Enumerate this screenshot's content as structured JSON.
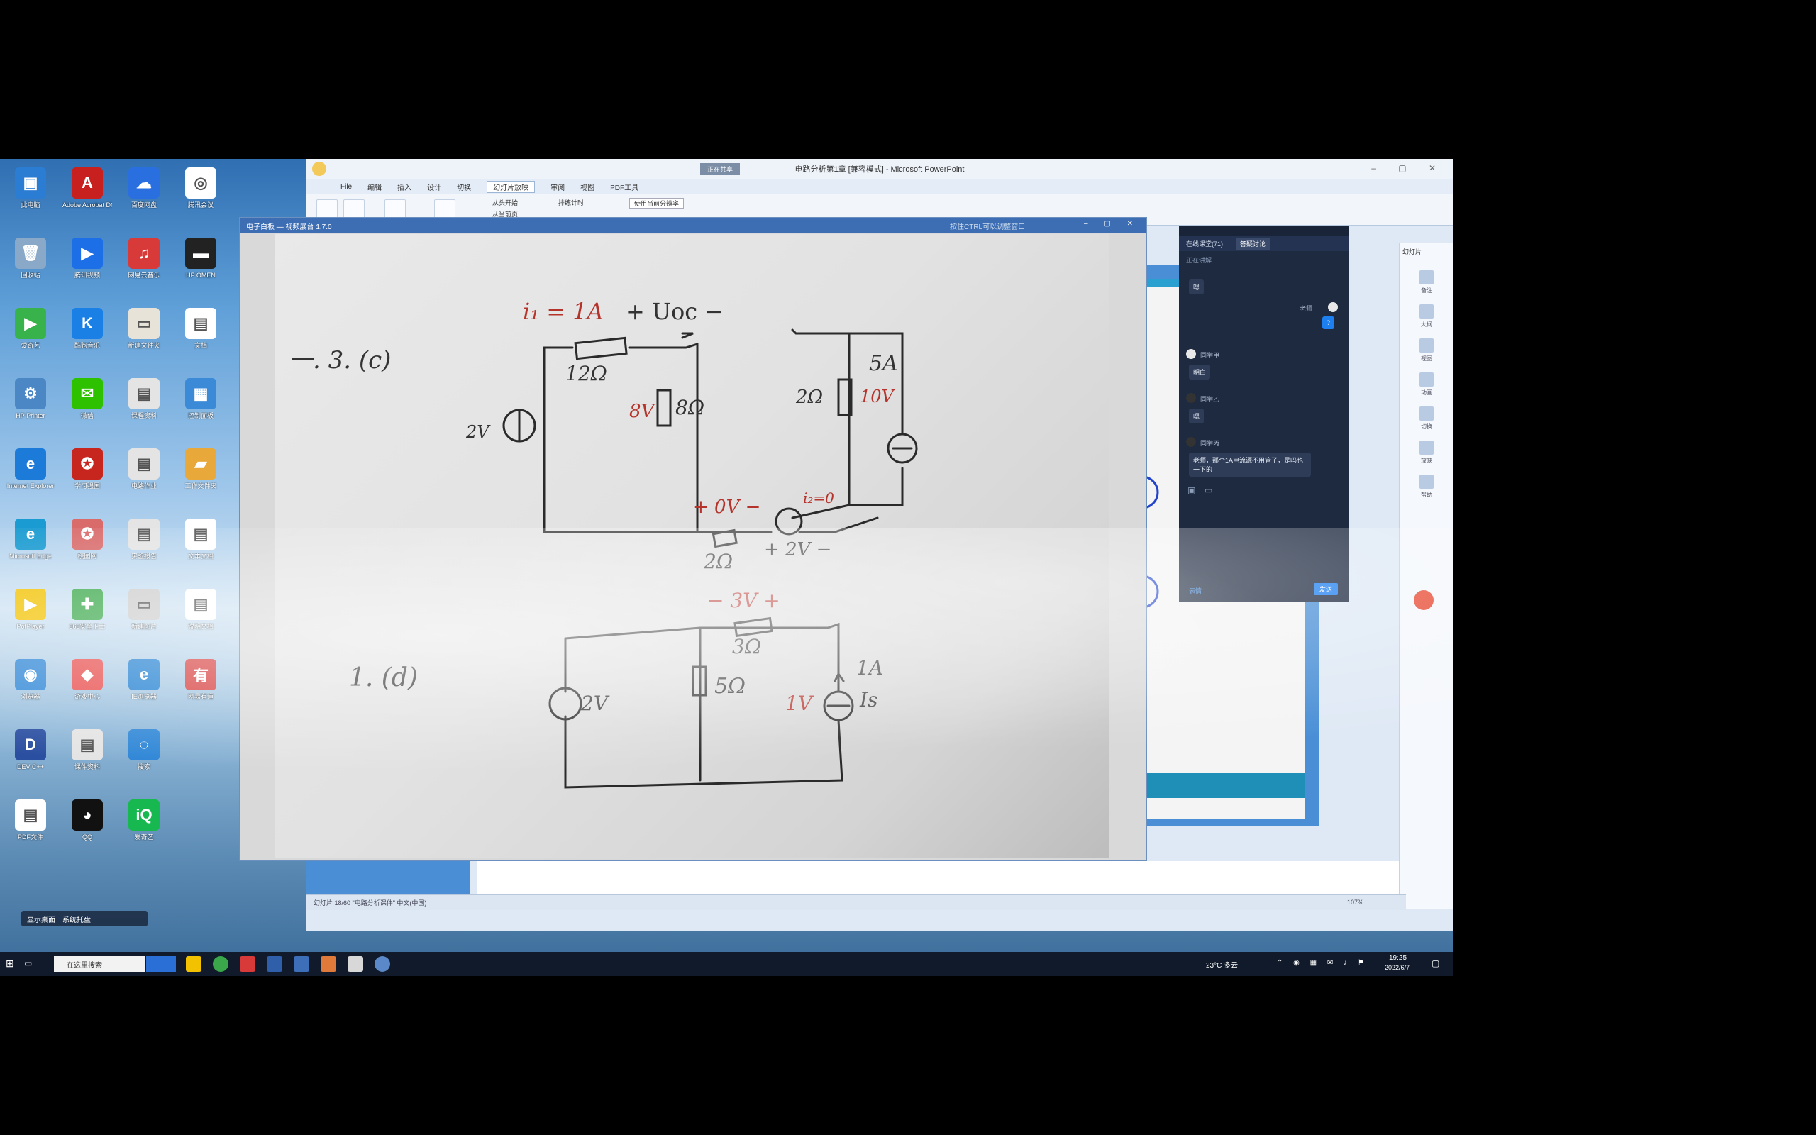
{
  "desktop_icons": [
    {
      "label": "此电脑",
      "color": "#2b7cd3",
      "glyph": "▣"
    },
    {
      "label": "Adobe Acrobat DC",
      "color": "#c8201e",
      "glyph": "A"
    },
    {
      "label": "百度网盘",
      "color": "#2a6fe0",
      "glyph": "☁"
    },
    {
      "label": "腾讯会议",
      "color": "#ffffff",
      "glyph": "◎"
    },
    {
      "label": "回收站",
      "color": "#8aa8c8",
      "glyph": "🗑"
    },
    {
      "label": "腾讯视频",
      "color": "#1d6fe8",
      "glyph": "▶"
    },
    {
      "label": "网易云音乐",
      "color": "#d83a3a",
      "glyph": "♫"
    },
    {
      "label": "HP OMEN",
      "color": "#222222",
      "glyph": "▬"
    },
    {
      "label": "爱奇艺",
      "color": "#38b24a",
      "glyph": "▶"
    },
    {
      "label": "酷狗音乐",
      "color": "#1a80e6",
      "glyph": "K"
    },
    {
      "label": "新建文件夹",
      "color": "#e8e3d9",
      "glyph": "▭"
    },
    {
      "label": "文档",
      "color": "#ffffff",
      "glyph": "▤"
    },
    {
      "label": "HP Printer",
      "color": "#4b87c4",
      "glyph": "⚙"
    },
    {
      "label": "微信",
      "color": "#2dc100",
      "glyph": "✉"
    },
    {
      "label": "课程资料",
      "color": "#e4e4e4",
      "glyph": "▤"
    },
    {
      "label": "控制面板",
      "color": "#3a8ad8",
      "glyph": "▦"
    },
    {
      "label": "Internet Explorer",
      "color": "#1c7bd8",
      "glyph": "e"
    },
    {
      "label": "学习强国",
      "color": "#c7261e",
      "glyph": "✪"
    },
    {
      "label": "电路作业",
      "color": "#e4e4e4",
      "glyph": "▤"
    },
    {
      "label": "工作文件夹",
      "color": "#e8a83a",
      "glyph": "▰"
    },
    {
      "label": "Microsoft Edge",
      "color": "#1a9bd1",
      "glyph": "e"
    },
    {
      "label": "校园网",
      "color": "#d96b6b",
      "glyph": "✪"
    },
    {
      "label": "实验报告",
      "color": "#e4e4e4",
      "glyph": "▤"
    },
    {
      "label": "文本文档",
      "color": "#ffffff",
      "glyph": "▤"
    },
    {
      "label": "PotPlayer",
      "color": "#f2c200",
      "glyph": "▶"
    },
    {
      "label": "360安全卫士",
      "color": "#3aa84a",
      "glyph": "✚"
    },
    {
      "label": "新建图片",
      "color": "#cccccc",
      "glyph": "▭"
    },
    {
      "label": "说明文档",
      "color": "#ffffff",
      "glyph": "▤"
    },
    {
      "label": "浏览器",
      "color": "#2e86d6",
      "glyph": "◉"
    },
    {
      "label": "游戏中心",
      "color": "#e84c4c",
      "glyph": "◆"
    },
    {
      "label": "IE浏览器",
      "color": "#1f7fd1",
      "glyph": "e"
    },
    {
      "label": "网易有道",
      "color": "#d63b3b",
      "glyph": "有"
    },
    {
      "label": "DEV C++",
      "color": "#2a4ea0",
      "glyph": "D"
    },
    {
      "label": "课件资料",
      "color": "#e4e4e4",
      "glyph": "▤"
    },
    {
      "label": "搜索",
      "color": "#2e86d6",
      "glyph": "◌"
    },
    {
      "label": "Internet Explorer",
      "color": "#1f7fd1",
      "glyph": "e"
    },
    {
      "label": "PDF文件",
      "color": "#ffffff",
      "glyph": "▤"
    },
    {
      "label": "QQ",
      "color": "#111111",
      "glyph": "◕"
    },
    {
      "label": "爱奇艺",
      "color": "#17b84f",
      "glyph": "iQ"
    }
  ],
  "desktop_toolbar": {
    "left_label": "显示桌面",
    "right_label": "系统托盘"
  },
  "ppt": {
    "window_title": "电路分析第1章 [兼容模式] - Microsoft PowerPoint",
    "title_badge": "正在共享",
    "menus": [
      "File",
      "编辑",
      "插入",
      "设计",
      "切换",
      "幻灯片放映",
      "审阅",
      "视图",
      "PDF工具"
    ],
    "active_menu": "幻灯片放映",
    "ribbon_texts": [
      "从头开始",
      "从当前页",
      "排练计时",
      "使用当前分辨率"
    ],
    "status_bar": "幻灯片 18/60   \"电路分析课件\"   中文(中国)",
    "zoom": "107%",
    "side_panel_title": "幻灯片",
    "side_panel_items": [
      "备注",
      "大纲",
      "视图",
      "动画",
      "切换",
      "放映",
      "帮助"
    ]
  },
  "camera": {
    "title": "电子白板 — 视频展台 1.7.0",
    "title_hint": "按住CTRL可以调整窗口",
    "problem_a": {
      "label": "一. 3. (c)",
      "i1": "i₁ = 1A",
      "r12": "12Ω",
      "r8": "8Ω",
      "v8": "8V",
      "uoc": "+  Uoc  −",
      "r2a": "2Ω",
      "v10": "10V",
      "i5": "5A",
      "v2left": "2V",
      "v0": "+ 0V −",
      "r2b": "2Ω",
      "v2b": "+ 2V −",
      "i2": "i₂=0"
    },
    "problem_b": {
      "label": "1. (d)",
      "v3": "− 3V +",
      "r3": "3Ω",
      "v2": "2V",
      "r5": "5Ω",
      "v1": "1V",
      "ia": "1A",
      "is": "Is"
    }
  },
  "chat": {
    "tabs": [
      "在线课堂(71)",
      "答疑讨论"
    ],
    "subtitle": "正在讲解",
    "messages": [
      {
        "name": "",
        "text": "嗯"
      },
      {
        "name": "老师",
        "text": "?"
      },
      {
        "name": "同学甲",
        "text": "明白"
      },
      {
        "name": "同学乙",
        "text": "嗯"
      },
      {
        "name": "同学丙",
        "text": "老师，那个1A电流源不用管了，是吗也一下的"
      }
    ],
    "footer_left": "表情",
    "footer_right": "发送"
  },
  "taskbar": {
    "search_text": "在这里搜索",
    "weather": "23°C 多云",
    "time": "19:25",
    "date": "2022/6/7"
  }
}
